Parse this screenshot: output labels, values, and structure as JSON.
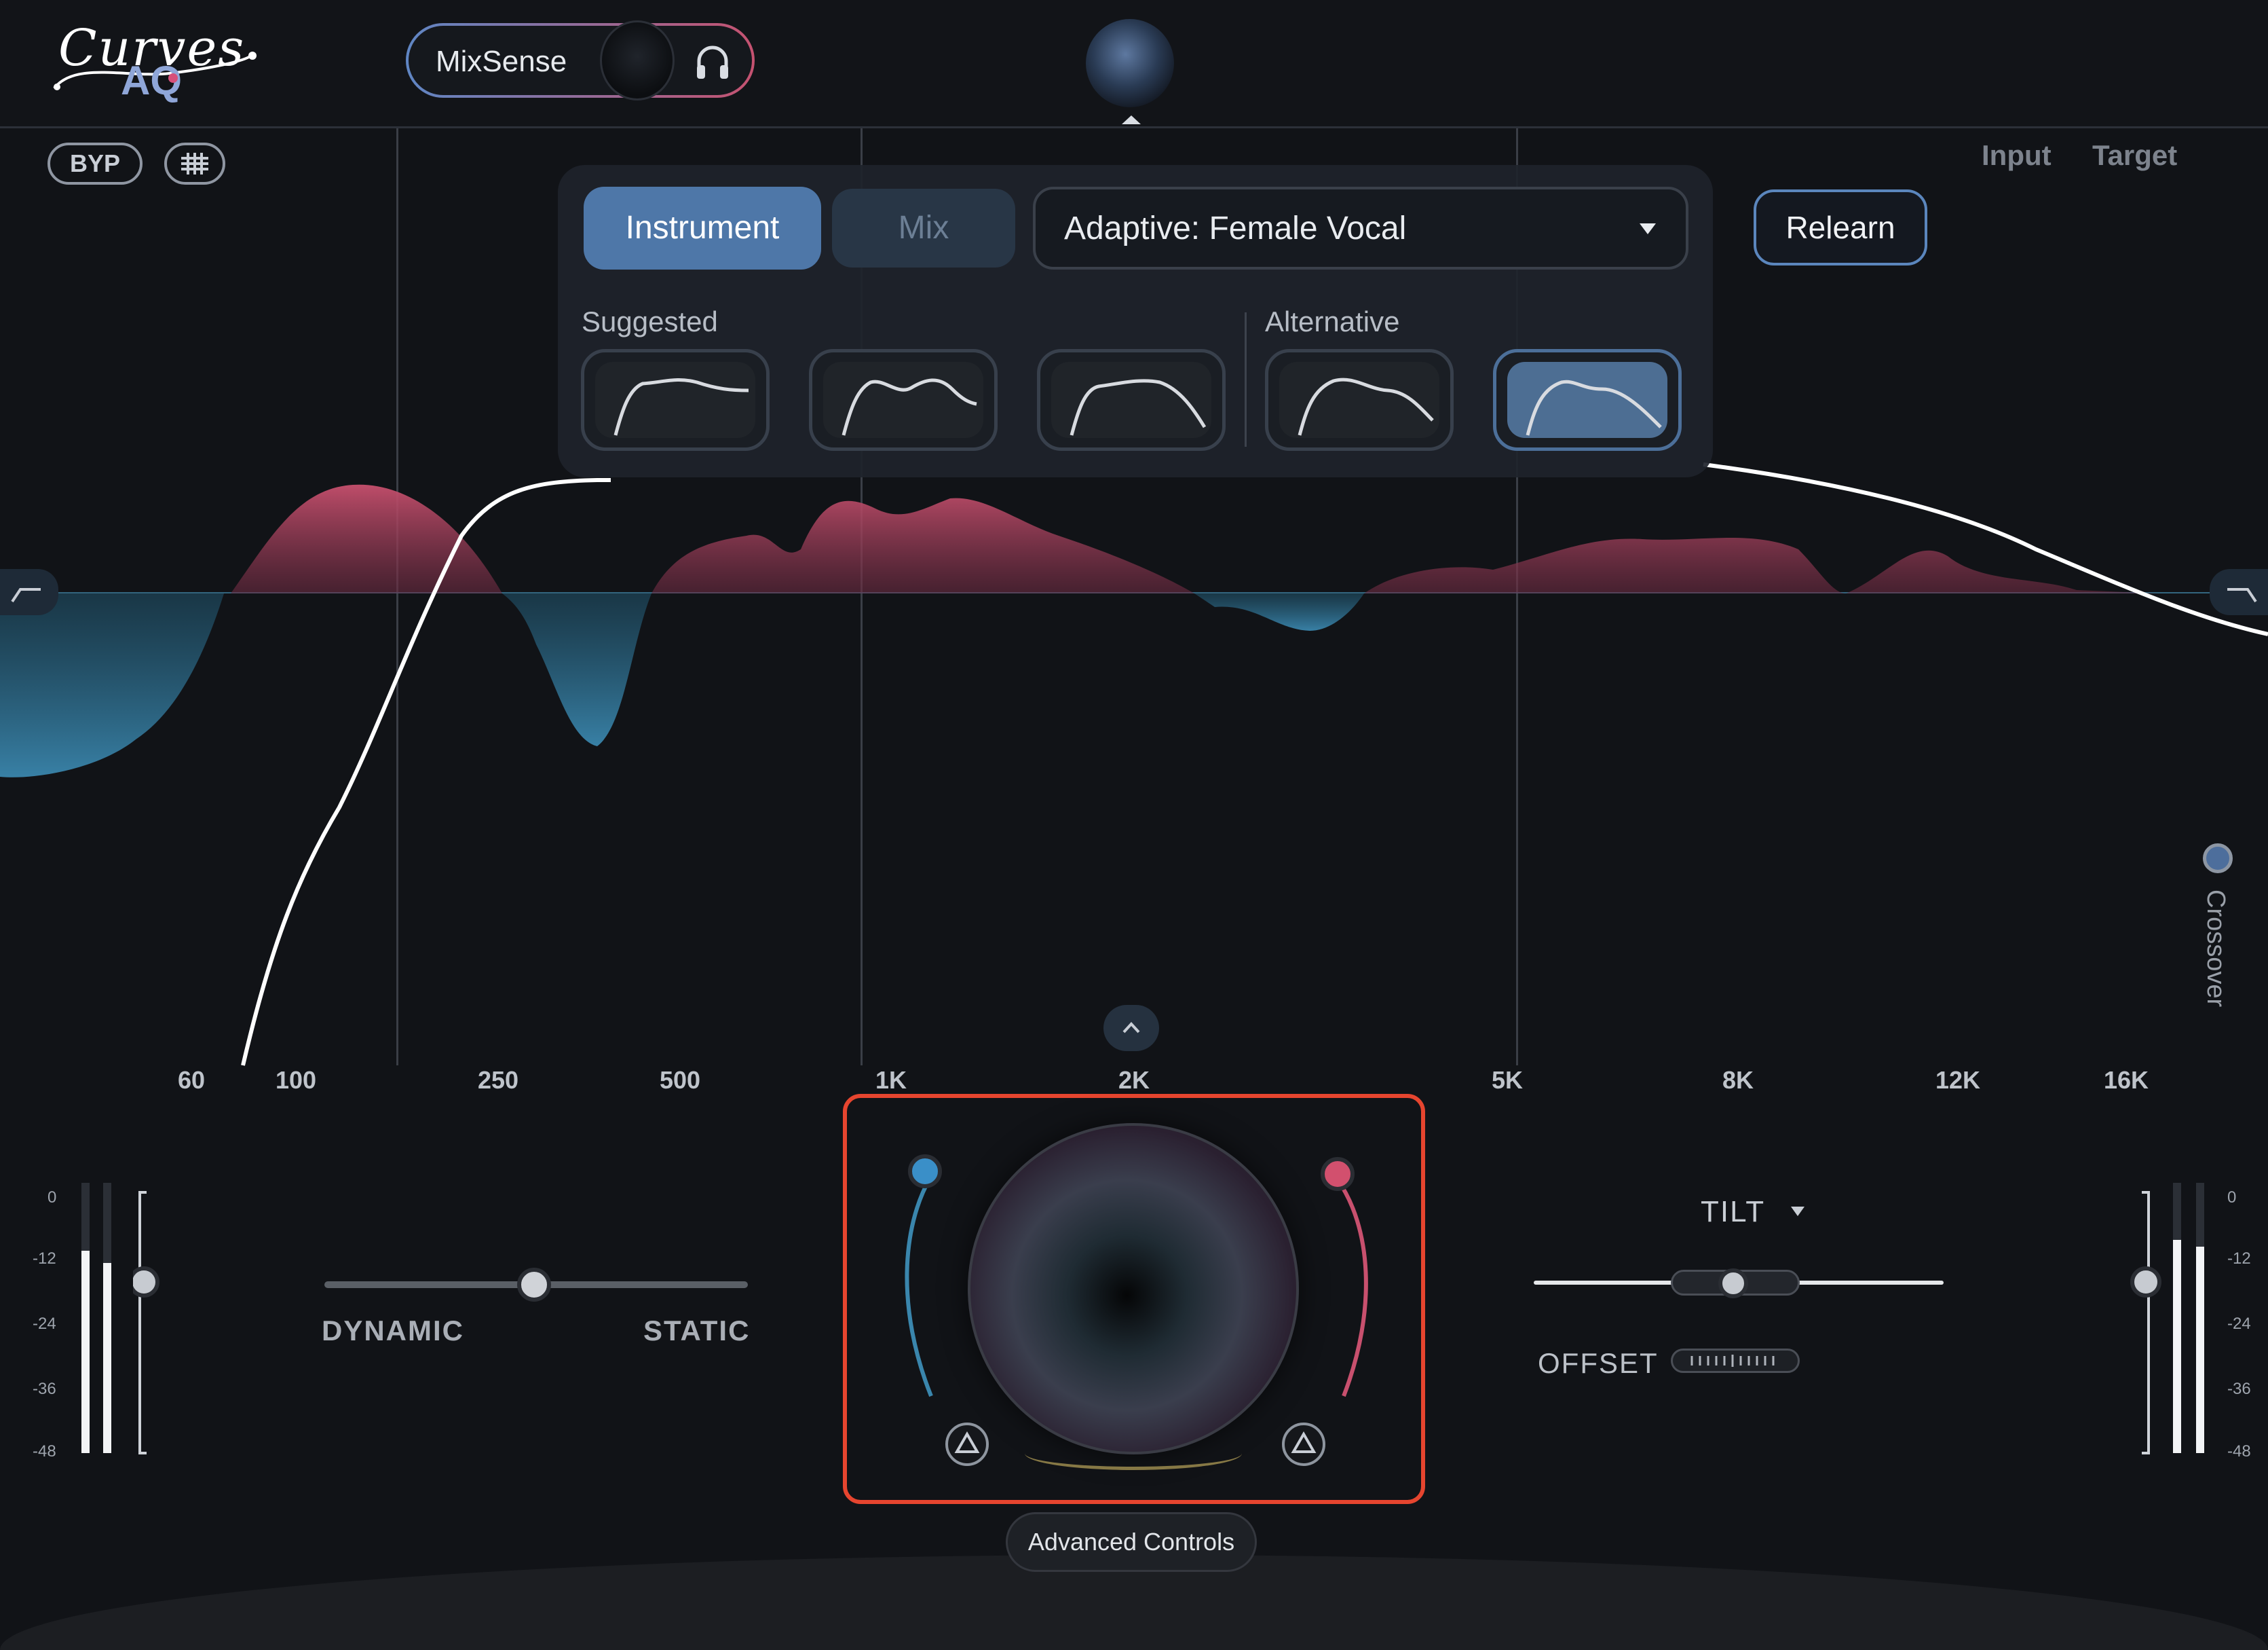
{
  "app": {
    "logo_top": "Curves",
    "logo_bottom": "AQ"
  },
  "header": {
    "mixsense_label": "MixSense",
    "headphones_icon": "headphones-icon"
  },
  "graph_toolbar": {
    "bypass_label": "BYP",
    "grid_icon": "grid-icon",
    "input_label": "Input",
    "target_label": "Target"
  },
  "target_panel": {
    "tabs": [
      {
        "label": "Instrument",
        "active": true
      },
      {
        "label": "Mix",
        "active": false
      }
    ],
    "profile_selected": "Adaptive: Female Vocal",
    "relearn_label": "Relearn",
    "suggested_label": "Suggested",
    "alternative_label": "Alternative",
    "selected_curve_index": 4
  },
  "frequency_axis": [
    "60",
    "100",
    "250",
    "500",
    "1K",
    "2K",
    "5K",
    "8K",
    "12K",
    "16K"
  ],
  "crossover_label": "Crossover",
  "meters": {
    "ticks": [
      "0",
      "-12",
      "-24",
      "-36",
      "-48"
    ]
  },
  "dynamics": {
    "left_label": "DYNAMIC",
    "right_label": "STATIC",
    "value_fraction": 0.47
  },
  "advanced": {
    "button_label": "Advanced Controls"
  },
  "tilt": {
    "label": "TILT",
    "offset_label": "OFFSET",
    "value_fraction": 0.5
  },
  "colors": {
    "accent_blue": "#4e77a8",
    "boost_pink": "#c8506e",
    "cut_blue": "#3a86ad",
    "highlight_red": "#e6452f"
  }
}
